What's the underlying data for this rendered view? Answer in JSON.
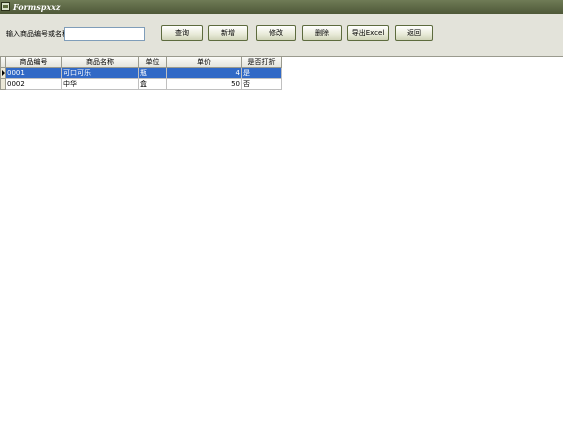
{
  "window": {
    "title": "Formspxxz"
  },
  "search": {
    "label": "输入商品编号或名称",
    "value": "",
    "placeholder": ""
  },
  "toolbar": {
    "query": "查询",
    "add": "新增",
    "edit": "修改",
    "delete": "删除",
    "export": "导出Excel",
    "back": "返回"
  },
  "grid": {
    "columns": [
      "商品编号",
      "商品名称",
      "单位",
      "单价",
      "是否打折"
    ],
    "rows": [
      {
        "id": "0001",
        "name": "可口可乐",
        "unit": "瓶",
        "price": "4",
        "discount": "是",
        "selected": true
      },
      {
        "id": "0002",
        "name": "中华",
        "unit": "盒",
        "price": "50",
        "discount": "否",
        "selected": false
      }
    ]
  }
}
